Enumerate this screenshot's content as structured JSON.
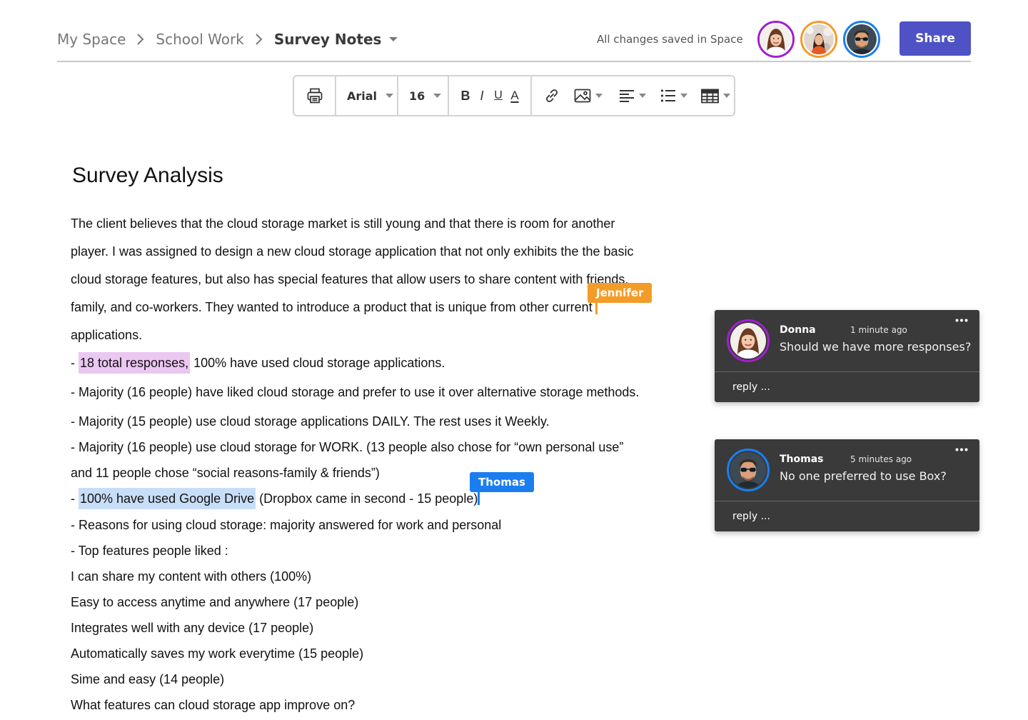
{
  "colors": {
    "accent": "#4f52c4",
    "jennifer": "#f39c28",
    "thomas": "#1a7ef0",
    "donna_ring": "#a020d0",
    "highlight_pink": "#ebc7f2",
    "highlight_blue": "#c8def8",
    "comment_bg": "#3a3a3a"
  },
  "breadcrumb": {
    "items": [
      "My Space",
      "School Work",
      "Survey Notes"
    ],
    "separator_icon": "chevron-right-icon",
    "dropdown_icon": "caret-down-icon"
  },
  "header": {
    "save_status": "All changes saved in Space",
    "share_label": "Share",
    "collaborators": [
      {
        "name": "Donna",
        "ring_color": "#a020d0"
      },
      {
        "name": "Jennifer",
        "ring_color": "#f39c28"
      },
      {
        "name": "Thomas",
        "ring_color": "#1a7ef0"
      }
    ]
  },
  "toolbar": {
    "print_icon": "printer-icon",
    "font": "Arial",
    "size": "16",
    "bold": "B",
    "italic": "I",
    "underline": "U",
    "text_color": "A",
    "icons": [
      "link-icon",
      "image-icon",
      "align-left-icon",
      "bullet-list-icon",
      "table-icon"
    ]
  },
  "document": {
    "title": "Survey Analysis",
    "para_lines": [
      "The client believes that the cloud storage market is still young and that there is room for another",
      "player. I was assigned to design a new cloud storage application that not only exhibits the the basic",
      "cloud storage features, but also has special features that allow users to share content with friends,",
      "family, and co-workers. They wanted to introduce a product that is unique from other current",
      "applications."
    ],
    "bullet1_prefix": "- ",
    "bullet1_highlight": "18 total responses,",
    "bullet1_rest": " 100% have used cloud storage applications.",
    "bullet2": "- Majority (16 people) have liked cloud storage and prefer to use it over alternative storage methods.",
    "bullet3": "- Majority (15 people) use cloud storage applications DAILY. The rest uses it Weekly.",
    "bullet4_line1": "- Majority (16 people) use cloud storage for WORK. (13 people also chose for “own personal use”",
    "bullet4_line2": "and 11 people chose “social reasons-family & friends”)",
    "bullet5_prefix": "- ",
    "bullet5_highlight": "100% have used Google Drive",
    "bullet5_rest": " (Dropbox came in second - 15 people)",
    "bullet6": "- Reasons for using cloud storage: majority answered for work and personal",
    "bullet7": "- Top features people liked :",
    "features": [
      "I can share my content with others (100%)",
      "Easy to access anytime and anywhere (17 people)",
      "Integrates well with any device (17 people)",
      "Automatically saves my work everytime (15 people)",
      "Sime and easy (14 people)",
      "What features can cloud storage app improve on?"
    ]
  },
  "cursors": {
    "jennifer": "Jennifer",
    "thomas": "Thomas"
  },
  "comments": [
    {
      "name": "Donna",
      "time": "1 minute ago",
      "text": "Should we have more responses?",
      "reply_placeholder": "reply ...",
      "more_icon": "more-dots-icon"
    },
    {
      "name": "Thomas",
      "time": "5 minutes ago",
      "text": "No one preferred to use Box?",
      "reply_placeholder": "reply ...",
      "more_icon": "more-dots-icon"
    }
  ]
}
